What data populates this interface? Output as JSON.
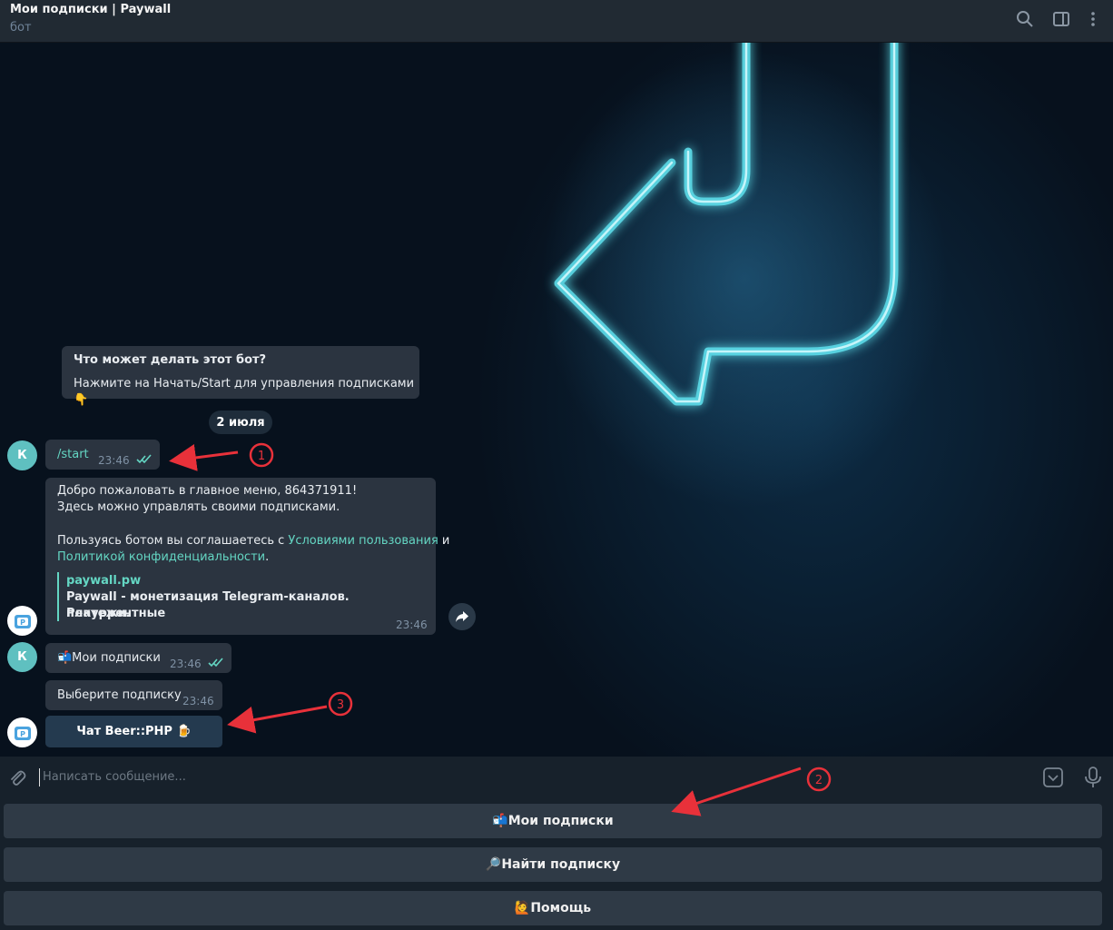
{
  "header": {
    "title": "Мои подписки | Paywall",
    "subtitle": "бот"
  },
  "bot_info": {
    "title": "Что может делать этот бот?",
    "text": "Нажмите на Начать/Start для управления подписками 👇"
  },
  "date_separator": "2 июля",
  "messages": {
    "start": {
      "avatar_letter": "К",
      "text": "/start",
      "time": "23:46"
    },
    "welcome": {
      "line1": "Добро пожаловать в главное меню, 864371911!",
      "line2": "Здесь можно управлять своими подписками.",
      "agree_prefix": "Пользуясь ботом вы соглашаетесь с ",
      "terms_link": "Условиями пользования",
      "and": " и",
      "privacy_link": "Политикой конфиденциальности",
      "period": ".",
      "preview_site": "paywall.pw",
      "preview_title_1": "Paywall - монетизация Telegram-каналов. Рекуррентные",
      "preview_title_2": "платежи.",
      "time": "23:46"
    },
    "my_subs": {
      "avatar_letter": "К",
      "text": "📬Мои подписки",
      "time": "23:46"
    },
    "choose": {
      "text": "Выберите подписку",
      "time": "23:46"
    },
    "inline_button": "Чат Beer::PHP 🍺"
  },
  "composer": {
    "placeholder": "Написать сообщение..."
  },
  "keyboard": {
    "my_subscriptions": "📬Мои подписки",
    "find_subscription": "🔎Найти подписку",
    "help": "🙋Помощь"
  },
  "annotations": {
    "one": "1",
    "two": "2",
    "three": "3"
  },
  "colors": {
    "accent": "#64d6c3",
    "annotation": "#e8313a",
    "bubble": "#2b3440"
  }
}
